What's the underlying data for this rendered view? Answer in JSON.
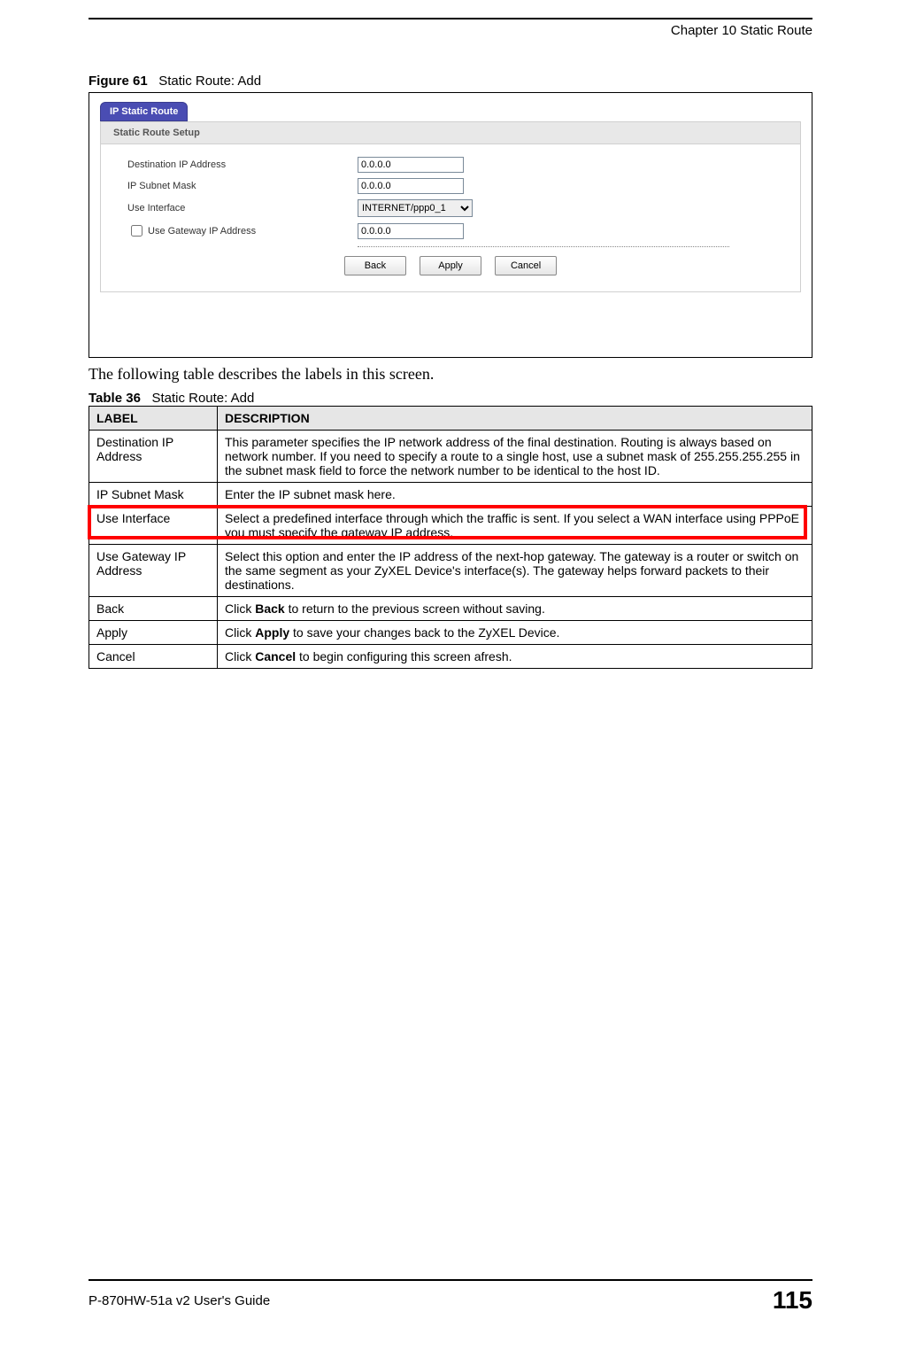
{
  "header": {
    "chapter": "Chapter 10 Static Route"
  },
  "figure": {
    "number_label": "Figure 61",
    "title": "Static Route: Add"
  },
  "screenshot": {
    "tab_title": "IP Static Route",
    "panel_title": "Static Route Setup",
    "labels": {
      "dest_ip": "Destination IP Address",
      "subnet": "IP Subnet Mask",
      "use_iface": "Use Interface",
      "use_gw": "Use Gateway IP Address"
    },
    "values": {
      "dest_ip": "0.0.0.0",
      "subnet": "0.0.0.0",
      "use_iface": "INTERNET/ppp0_1",
      "gw_ip": "0.0.0.0"
    },
    "buttons": {
      "back": "Back",
      "apply": "Apply",
      "cancel": "Cancel"
    }
  },
  "intro_text": "The following table describes the labels in this screen.",
  "table_caption": {
    "number_label": "Table 36",
    "title": "Static Route: Add"
  },
  "table": {
    "headers": {
      "label": "LABEL",
      "desc": "DESCRIPTION"
    },
    "rows": [
      {
        "label": "Destination IP Address",
        "desc": "This parameter specifies the IP network address of the final destination.  Routing is always based on network number. If you need to specify a route to a single host, use a subnet mask of 255.255.255.255 in the subnet mask field to force the network number to be identical to the host ID."
      },
      {
        "label": "IP Subnet Mask",
        "desc": "Enter the IP subnet mask here."
      },
      {
        "label": "Use Interface",
        "desc": "Select a predefined interface through which the traffic is sent. If you select a WAN interface using PPPoE you must specify the gateway IP address."
      },
      {
        "label": "Use Gateway IP Address",
        "desc": "Select this option and enter the IP address of the next-hop gateway. The gateway is a router or switch on the same segment as your ZyXEL Device's interface(s). The gateway helps forward packets to their destinations."
      },
      {
        "label": "Back",
        "desc_pre": "Click ",
        "desc_bold": "Back",
        "desc_post": " to return to the previous screen without saving."
      },
      {
        "label": "Apply",
        "desc_pre": "Click ",
        "desc_bold": "Apply",
        "desc_post": " to save your changes back to the ZyXEL Device."
      },
      {
        "label": "Cancel",
        "desc_pre": "Click ",
        "desc_bold": "Cancel",
        "desc_post": " to begin configuring this screen afresh."
      }
    ]
  },
  "footer": {
    "guide": "P-870HW-51a v2 User's Guide",
    "page_number": "115"
  }
}
